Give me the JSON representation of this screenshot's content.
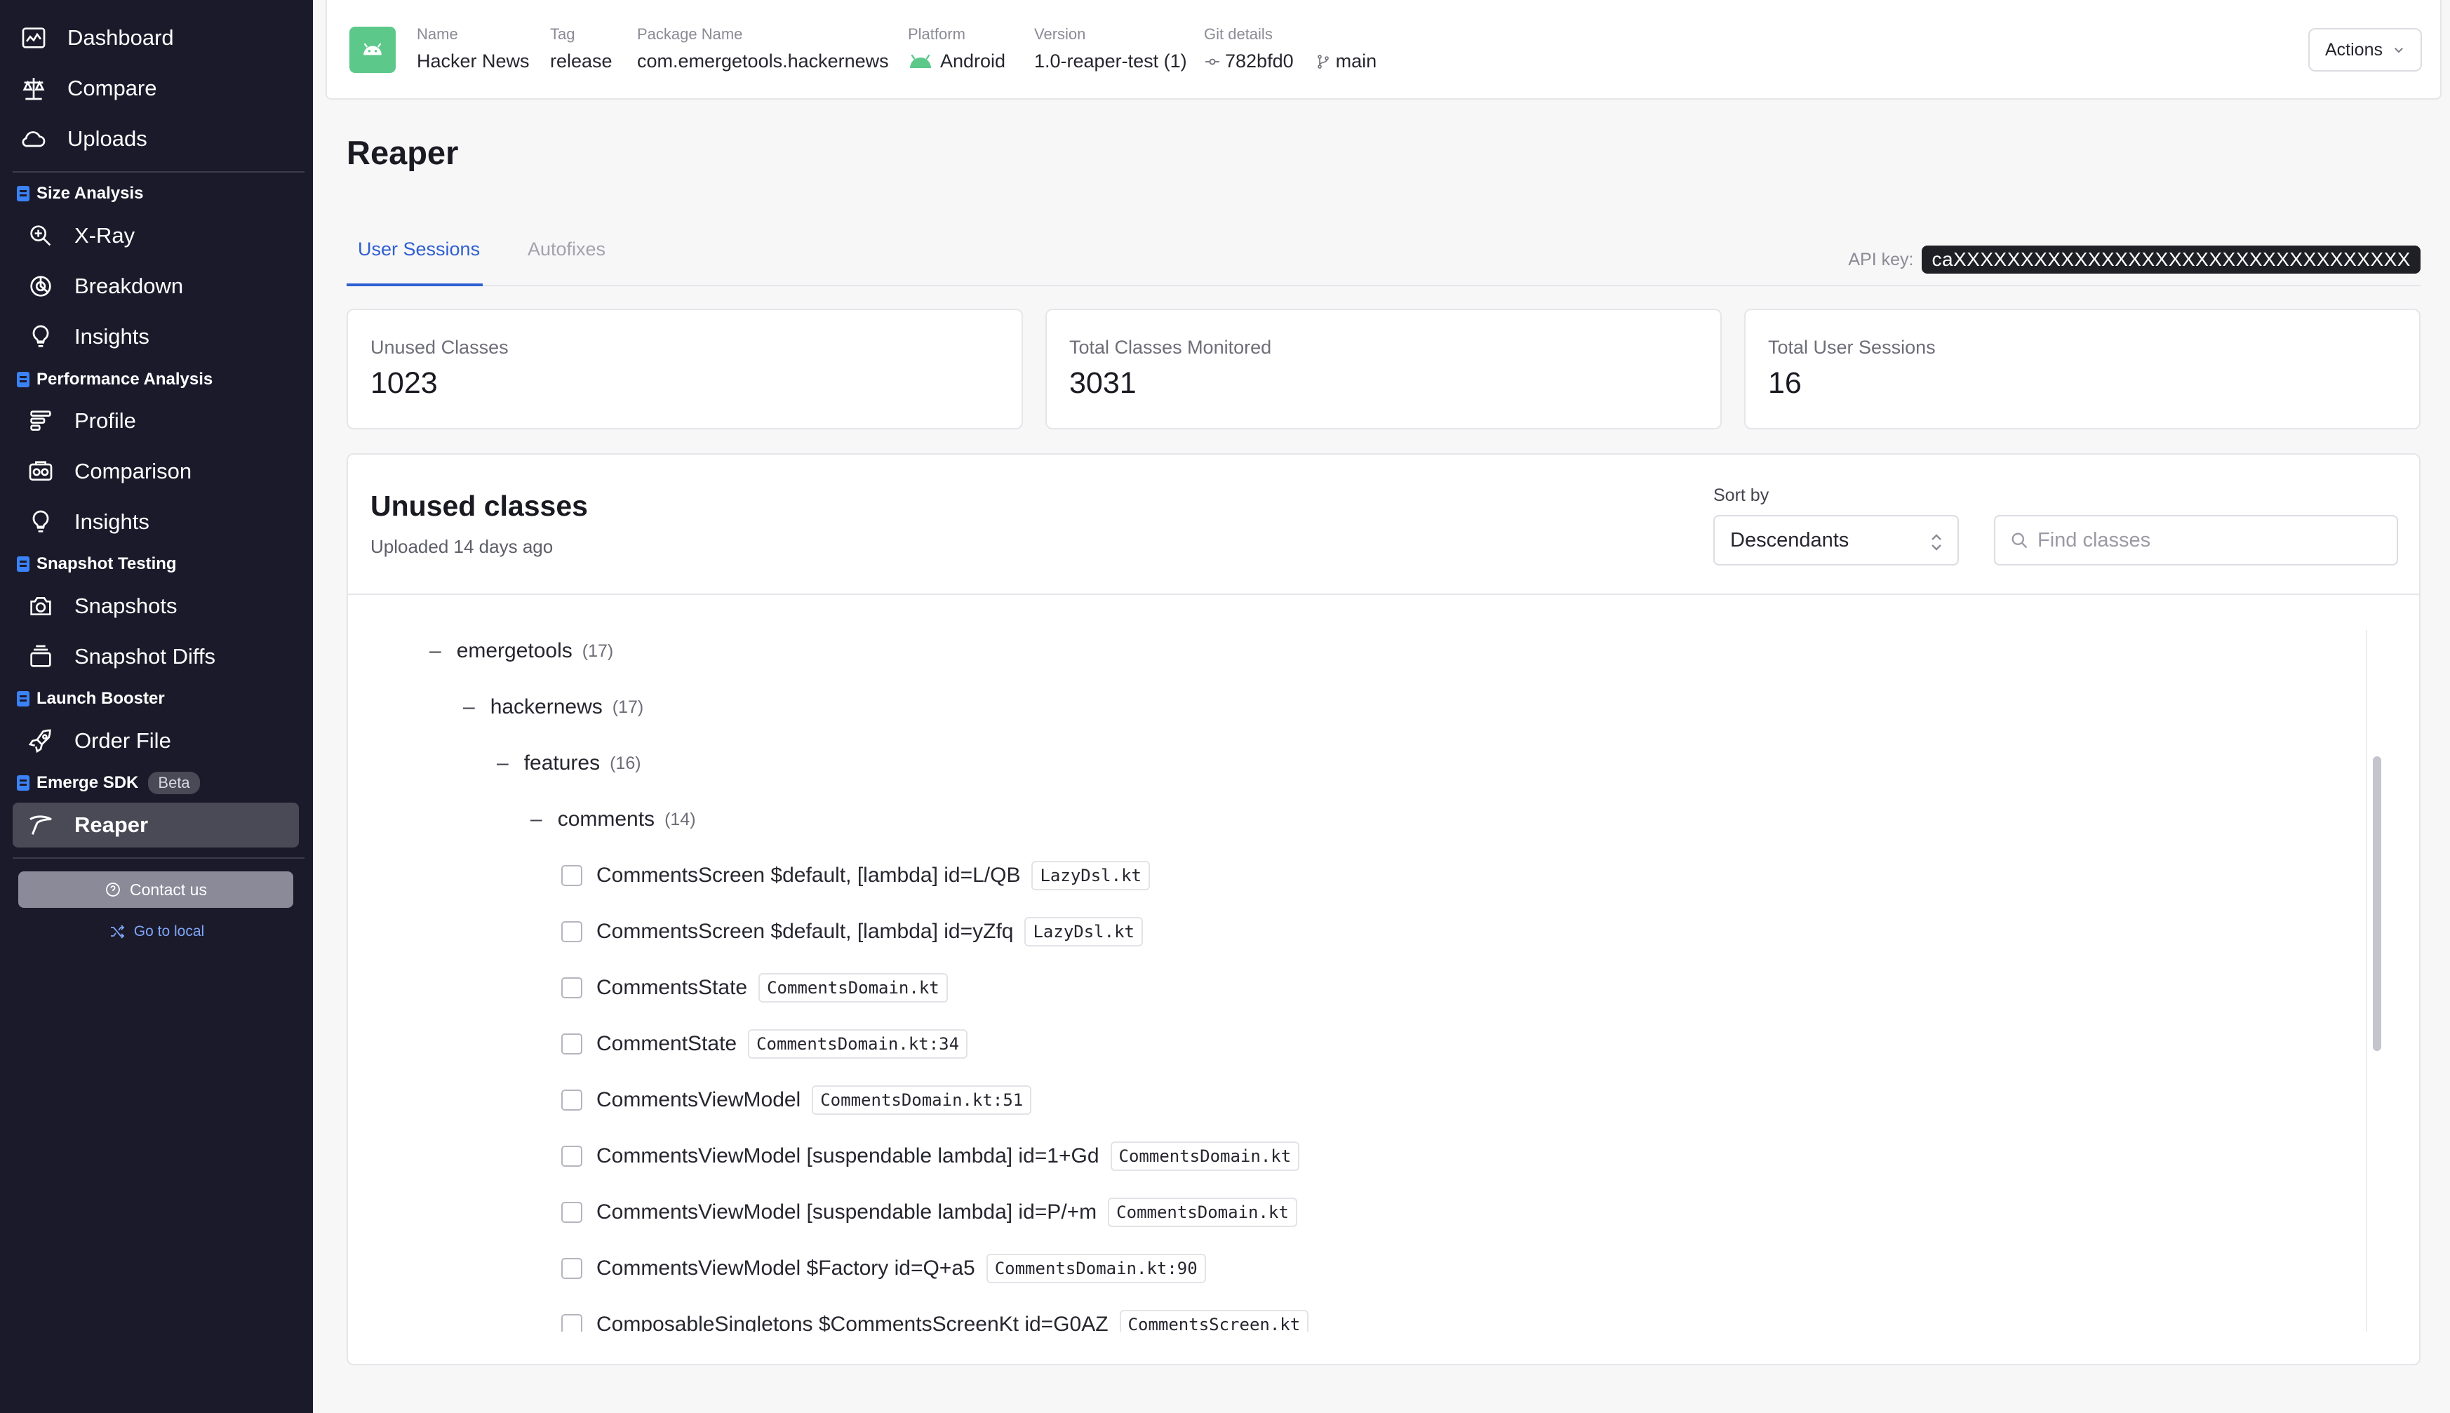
{
  "sidebar": {
    "top_items": [
      {
        "label": "Dashboard",
        "icon": "dashboard-icon"
      },
      {
        "label": "Compare",
        "icon": "scale-icon"
      },
      {
        "label": "Uploads",
        "icon": "cloud-icon"
      }
    ],
    "sections": [
      {
        "title": "Size Analysis",
        "items": [
          {
            "label": "X-Ray",
            "icon": "zoom-icon"
          },
          {
            "label": "Breakdown",
            "icon": "pie-chart-icon"
          },
          {
            "label": "Insights",
            "icon": "lightbulb-icon"
          }
        ]
      },
      {
        "title": "Performance Analysis",
        "items": [
          {
            "label": "Profile",
            "icon": "flame-graph-icon"
          },
          {
            "label": "Comparison",
            "icon": "comparison-icon"
          },
          {
            "label": "Insights",
            "icon": "lightbulb-icon"
          }
        ]
      },
      {
        "title": "Snapshot Testing",
        "items": [
          {
            "label": "Snapshots",
            "icon": "camera-icon"
          },
          {
            "label": "Snapshot Diffs",
            "icon": "layers-icon"
          }
        ]
      },
      {
        "title": "Launch Booster",
        "items": [
          {
            "label": "Order File",
            "icon": "rocket-icon"
          }
        ]
      },
      {
        "title": "Emerge SDK",
        "badge": "Beta",
        "items": [
          {
            "label": "Reaper",
            "icon": "scythe-icon",
            "active": true
          }
        ]
      }
    ],
    "contact_label": "Contact us",
    "local_label": "Go to local"
  },
  "header": {
    "name_label": "Name",
    "name_value": "Hacker News",
    "tag_label": "Tag",
    "tag_value": "release",
    "package_label": "Package Name",
    "package_value": "com.emergetools.hackernews",
    "platform_label": "Platform",
    "platform_value": "Android",
    "version_label": "Version",
    "version_value": "1.0-reaper-test (1)",
    "git_label": "Git details",
    "git_commit": "782bfd0",
    "git_branch": "main",
    "actions_label": "Actions"
  },
  "page": {
    "title": "Reaper",
    "tabs": [
      {
        "label": "User Sessions",
        "active": true
      },
      {
        "label": "Autofixes",
        "active": false
      }
    ],
    "api_key_label": "API key:",
    "api_key_value": "caXXXXXXXXXXXXXXXXXXXXXXXXXXXXXXXXXX"
  },
  "stats": [
    {
      "label": "Unused Classes",
      "value": "1023"
    },
    {
      "label": "Total Classes Monitored",
      "value": "3031"
    },
    {
      "label": "Total User Sessions",
      "value": "16"
    }
  ],
  "unused": {
    "title": "Unused classes",
    "subtitle": "Uploaded 14 days ago",
    "sort_label": "Sort by",
    "sort_value": "Descendants",
    "search_placeholder": "Find classes",
    "tree": [
      {
        "depth": 0,
        "type": "folder",
        "name": "emergetools",
        "count": "(17)"
      },
      {
        "depth": 1,
        "type": "folder",
        "name": "hackernews",
        "count": "(17)"
      },
      {
        "depth": 2,
        "type": "folder",
        "name": "features",
        "count": "(16)"
      },
      {
        "depth": 3,
        "type": "folder",
        "name": "comments",
        "count": "(14)"
      },
      {
        "depth": 4,
        "type": "class",
        "name": "CommentsScreen $default, [lambda] id=L/QB",
        "file": "LazyDsl.kt"
      },
      {
        "depth": 4,
        "type": "class",
        "name": "CommentsScreen $default, [lambda] id=yZfq",
        "file": "LazyDsl.kt"
      },
      {
        "depth": 4,
        "type": "class",
        "name": "CommentsState",
        "file": "CommentsDomain.kt"
      },
      {
        "depth": 4,
        "type": "class",
        "name": "CommentState",
        "file": "CommentsDomain.kt:34"
      },
      {
        "depth": 4,
        "type": "class",
        "name": "CommentsViewModel",
        "file": "CommentsDomain.kt:51"
      },
      {
        "depth": 4,
        "type": "class",
        "name": "CommentsViewModel [suspendable lambda] id=1+Gd",
        "file": "CommentsDomain.kt"
      },
      {
        "depth": 4,
        "type": "class",
        "name": "CommentsViewModel [suspendable lambda] id=P/+m",
        "file": "CommentsDomain.kt"
      },
      {
        "depth": 4,
        "type": "class",
        "name": "CommentsViewModel $Factory id=Q+a5",
        "file": "CommentsDomain.kt:90"
      },
      {
        "depth": 4,
        "type": "class",
        "name": "ComposableSingletons $CommentsScreenKt id=G0AZ",
        "file": "CommentsScreen.kt"
      }
    ]
  },
  "colors": {
    "accent": "#2f5fd0",
    "sidebar_bg": "#1b1a2b",
    "section_marker": "#3b82f6",
    "android_green": "#5cc98a"
  }
}
